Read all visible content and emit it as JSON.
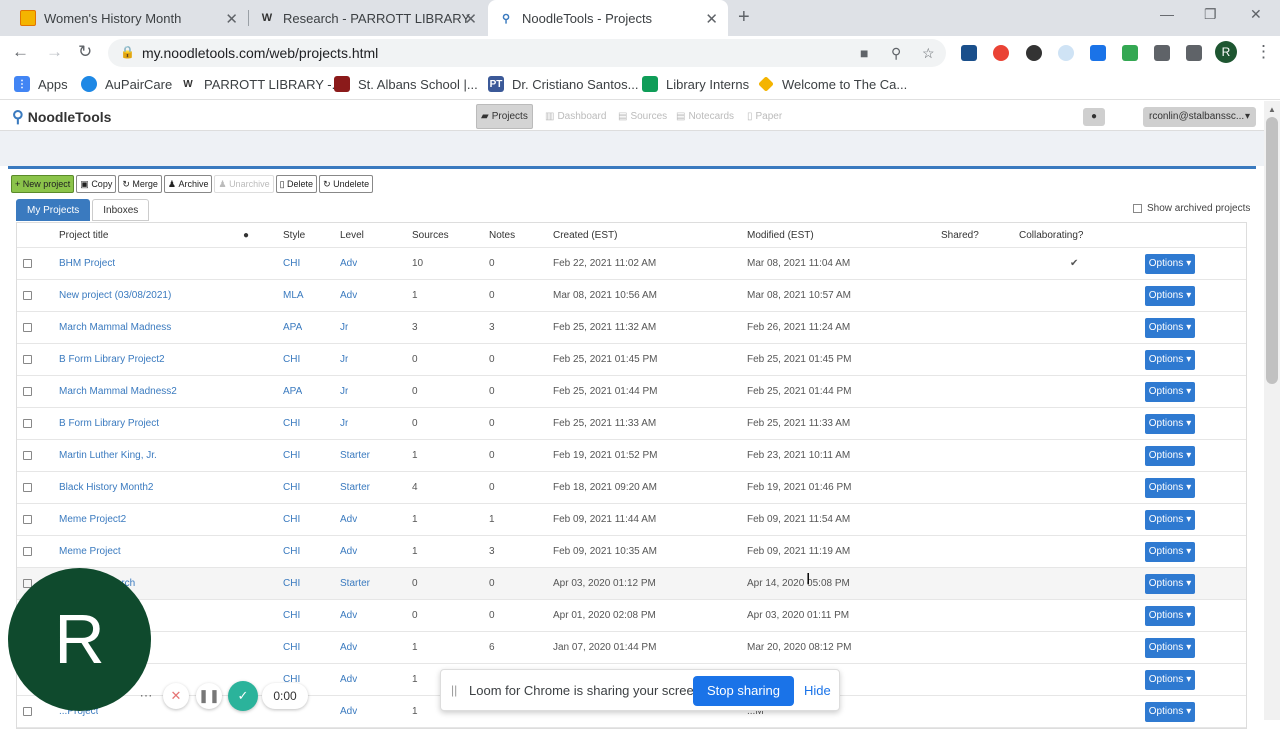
{
  "browser": {
    "tabs": [
      {
        "title": "Women's History Month",
        "icon": "slides-icon",
        "color": "#f4b400"
      },
      {
        "title": "Research - PARROTT LIBRARY",
        "icon": "w-icon",
        "color": "#333333"
      },
      {
        "title": "NoodleTools - Projects",
        "icon": "noodletools-icon",
        "color": "#3a7abf"
      }
    ],
    "url": "my.noodletools.com/web/projects.html",
    "profile_initial": "R",
    "bookmarks": [
      {
        "label": "Apps",
        "color": "#4285f4"
      },
      {
        "label": "AuPairCare",
        "color": "#1e88e5"
      },
      {
        "label": "PARROTT LIBRARY -...",
        "color": "#333333"
      },
      {
        "label": "St. Albans School |...",
        "color": "#8b1a1a"
      },
      {
        "label": "Dr. Cristiano Santos...",
        "color": "#3b5998"
      },
      {
        "label": "Library Interns",
        "color": "#0f9d58"
      },
      {
        "label": "Welcome to The Ca...",
        "color": "#f4b400"
      }
    ]
  },
  "app": {
    "logo": "NoodleTools",
    "nav": [
      "Projects",
      "Dashboard",
      "Sources",
      "Notecards",
      "Paper"
    ],
    "user": "rconlin@stalbanssc..."
  },
  "actions": [
    "New project",
    "Copy",
    "Merge",
    "Archive",
    "Unarchive",
    "Delete",
    "Undelete"
  ],
  "subtabs": [
    "My Projects",
    "Inboxes"
  ],
  "show_archived": "Show archived projects",
  "columns": [
    "Project title",
    "Style",
    "Level",
    "Sources",
    "Notes",
    "Created (EST)",
    "Modified (EST)",
    "Shared?",
    "Collaborating?"
  ],
  "options_label": "Options",
  "rows": [
    {
      "title": "BHM Project",
      "style": "CHI",
      "level": "Adv",
      "sources": "10",
      "notes": "0",
      "created": "Feb 22, 2021 11:02 AM",
      "modified": "Mar 08, 2021 11:04 AM",
      "collab": "✔"
    },
    {
      "title": "New project (03/08/2021)",
      "style": "MLA",
      "level": "Adv",
      "sources": "1",
      "notes": "0",
      "created": "Mar 08, 2021 10:56 AM",
      "modified": "Mar 08, 2021 10:57 AM",
      "collab": ""
    },
    {
      "title": "March Mammal Madness",
      "style": "APA",
      "level": "Jr",
      "sources": "3",
      "notes": "3",
      "created": "Feb 25, 2021 11:32 AM",
      "modified": "Feb 26, 2021 11:24 AM",
      "collab": ""
    },
    {
      "title": "B Form Library Project2",
      "style": "CHI",
      "level": "Jr",
      "sources": "0",
      "notes": "0",
      "created": "Feb 25, 2021 01:45 PM",
      "modified": "Feb 25, 2021 01:45 PM",
      "collab": ""
    },
    {
      "title": "March Mammal Madness2",
      "style": "APA",
      "level": "Jr",
      "sources": "0",
      "notes": "0",
      "created": "Feb 25, 2021 01:44 PM",
      "modified": "Feb 25, 2021 01:44 PM",
      "collab": ""
    },
    {
      "title": "B Form Library Project",
      "style": "CHI",
      "level": "Jr",
      "sources": "0",
      "notes": "0",
      "created": "Feb 25, 2021 11:33 AM",
      "modified": "Feb 25, 2021 11:33 AM",
      "collab": ""
    },
    {
      "title": "Martin Luther King, Jr.",
      "style": "CHI",
      "level": "Starter",
      "sources": "1",
      "notes": "0",
      "created": "Feb 19, 2021 01:52 PM",
      "modified": "Feb 23, 2021 10:11 AM",
      "collab": ""
    },
    {
      "title": "Black History Month2",
      "style": "CHI",
      "level": "Starter",
      "sources": "4",
      "notes": "0",
      "created": "Feb 18, 2021 09:20 AM",
      "modified": "Feb 19, 2021 01:46 PM",
      "collab": ""
    },
    {
      "title": "Meme Project2",
      "style": "CHI",
      "level": "Adv",
      "sources": "1",
      "notes": "1",
      "created": "Feb 09, 2021 11:44 AM",
      "modified": "Feb 09, 2021 11:54 AM",
      "collab": ""
    },
    {
      "title": "Meme Project",
      "style": "CHI",
      "level": "Adv",
      "sources": "1",
      "notes": "3",
      "created": "Feb 09, 2021 10:35 AM",
      "modified": "Feb 09, 2021 11:19 AM",
      "collab": ""
    },
    {
      "title": "...erest Research",
      "style": "CHI",
      "level": "Starter",
      "sources": "0",
      "notes": "0",
      "created": "Apr 03, 2020 01:12 PM",
      "modified": "Apr 14, 2020 05:08 PM",
      "collab": ""
    },
    {
      "title": "",
      "style": "CHI",
      "level": "Adv",
      "sources": "0",
      "notes": "0",
      "created": "Apr 01, 2020 02:08 PM",
      "modified": "Apr 03, 2020 01:11 PM",
      "collab": ""
    },
    {
      "title": "...d the V...",
      "style": "CHI",
      "level": "Adv",
      "sources": "1",
      "notes": "6",
      "created": "Jan 07, 2020 01:44 PM",
      "modified": "Mar 20, 2020 08:12 PM",
      "collab": ""
    },
    {
      "title": "...ect",
      "style": "CHI",
      "level": "Adv",
      "sources": "1",
      "notes": "",
      "created": "",
      "modified": "...M",
      "collab": ""
    },
    {
      "title": "...Project",
      "style": "",
      "level": "Adv",
      "sources": "1",
      "notes": "",
      "created": "",
      "modified": "...M",
      "collab": ""
    }
  ],
  "overlay": {
    "avatar_initial": "R",
    "timer": "0:00",
    "loom_message": "Loom for Chrome is sharing your screen.",
    "stop_label": "Stop sharing",
    "hide_label": "Hide"
  }
}
